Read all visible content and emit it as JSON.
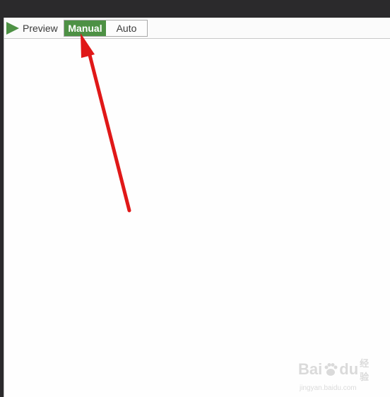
{
  "toolbar": {
    "preview_label": "Preview",
    "mode": {
      "manual_label": "Manual",
      "auto_label": "Auto",
      "selected": "Manual"
    }
  },
  "watermark": {
    "brand": "Bai",
    "brand_suffix": "du",
    "cn": "经验",
    "url": "jingyan.baidu.com"
  },
  "colors": {
    "accent_green": "#4d9144",
    "annotation_red": "#e01818",
    "titlebar": "#2b2a2c"
  }
}
